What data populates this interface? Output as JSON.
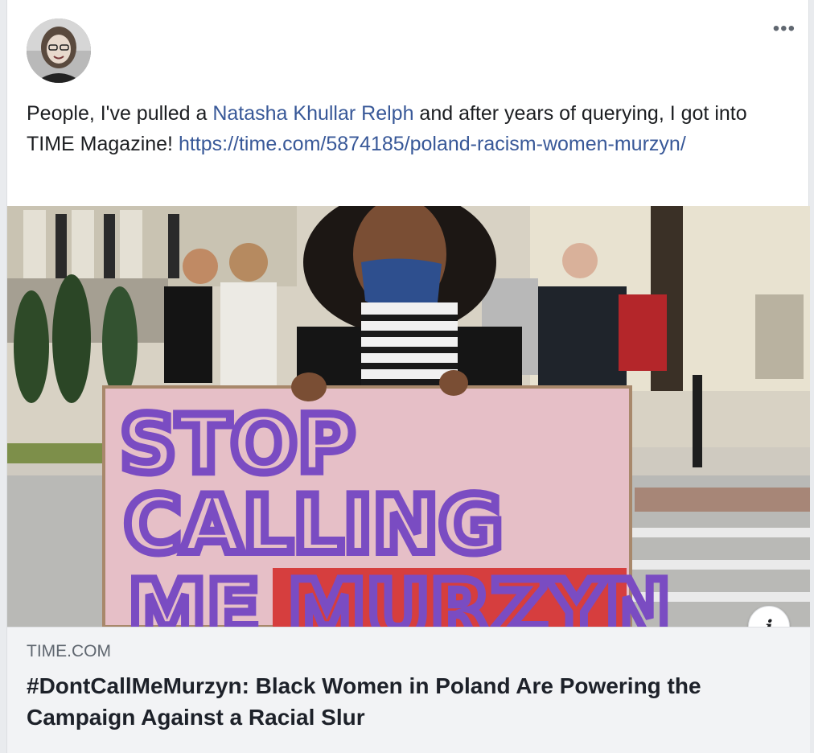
{
  "post": {
    "text_before": "People, I've pulled a ",
    "mention": "Natasha Khullar Relph",
    "text_middle": " and after years of querying, I got into TIME Magazine! ",
    "link_url": "https://time.com/5874185/poland-racism-women-murzyn/",
    "more_icon": "•••"
  },
  "link_preview": {
    "domain": "TIME.COM",
    "headline": "#DontCallMeMurzyn: Black Women in Poland Are Powering the Campaign Against a Racial Slur",
    "info_icon": "i",
    "image": {
      "sign_line1": "STOP",
      "sign_line2": "CALLING",
      "sign_line3": "ME MURZYN"
    }
  },
  "colors": {
    "link": "#385898",
    "text": "#1c1e21",
    "preview_bg": "#f2f3f5"
  }
}
